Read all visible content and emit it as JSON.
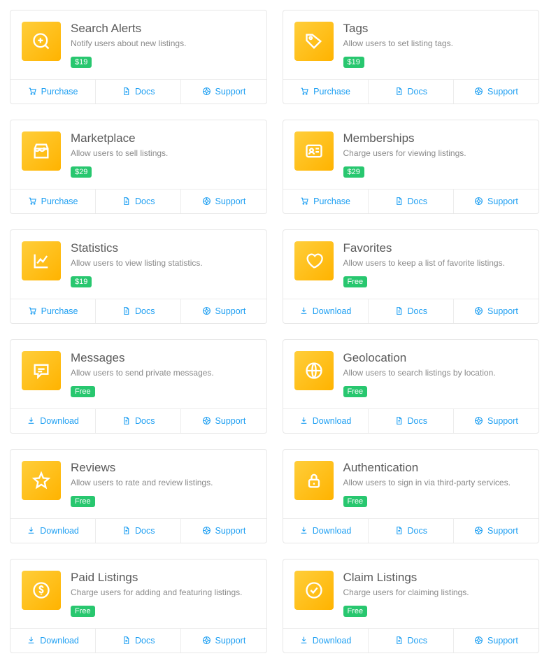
{
  "labels": {
    "purchase": "Purchase",
    "download": "Download",
    "docs": "Docs",
    "support": "Support"
  },
  "cards": [
    {
      "icon": "search-plus",
      "title": "Search Alerts",
      "desc": "Notify users about new listings.",
      "badge": "$19",
      "primary": "purchase"
    },
    {
      "icon": "tag",
      "title": "Tags",
      "desc": "Allow users to set listing tags.",
      "badge": "$19",
      "primary": "purchase"
    },
    {
      "icon": "store",
      "title": "Marketplace",
      "desc": "Allow users to sell listings.",
      "badge": "$29",
      "primary": "purchase"
    },
    {
      "icon": "id-card",
      "title": "Memberships",
      "desc": "Charge users for viewing listings.",
      "badge": "$29",
      "primary": "purchase"
    },
    {
      "icon": "chart",
      "title": "Statistics",
      "desc": "Allow users to view listing statistics.",
      "badge": "$19",
      "primary": "purchase"
    },
    {
      "icon": "heart",
      "title": "Favorites",
      "desc": "Allow users to keep a list of favorite listings.",
      "badge": "Free",
      "primary": "download"
    },
    {
      "icon": "message",
      "title": "Messages",
      "desc": "Allow users to send private messages.",
      "badge": "Free",
      "primary": "download"
    },
    {
      "icon": "globe",
      "title": "Geolocation",
      "desc": "Allow users to search listings by location.",
      "badge": "Free",
      "primary": "download"
    },
    {
      "icon": "star",
      "title": "Reviews",
      "desc": "Allow users to rate and review listings.",
      "badge": "Free",
      "primary": "download"
    },
    {
      "icon": "lock",
      "title": "Authentication",
      "desc": "Allow users to sign in via third-party services.",
      "badge": "Free",
      "primary": "download"
    },
    {
      "icon": "dollar",
      "title": "Paid Listings",
      "desc": "Charge users for adding and featuring listings.",
      "badge": "Free",
      "primary": "download"
    },
    {
      "icon": "check",
      "title": "Claim Listings",
      "desc": "Charge users for claiming listings.",
      "badge": "Free",
      "primary": "download"
    }
  ]
}
